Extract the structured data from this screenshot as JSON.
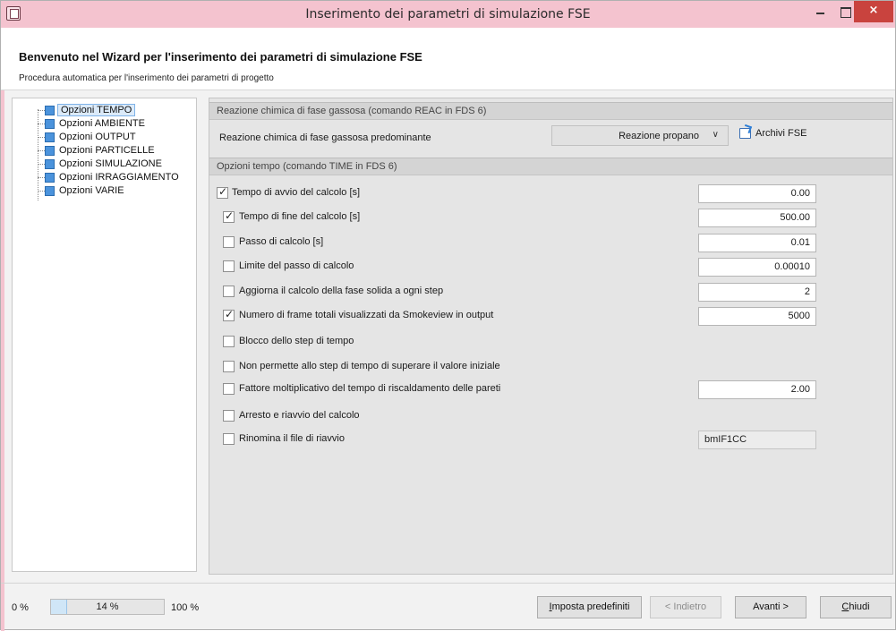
{
  "window": {
    "title": "Inserimento dei parametri di simulazione FSE",
    "close_symbol": "×"
  },
  "header": {
    "title": "Benvenuto nel Wizard per l'inserimento dei parametri di simulazione FSE",
    "subtitle": "Procedura automatica per l'inserimento dei parametri di progetto"
  },
  "tree": {
    "items": [
      {
        "label": "Opzioni TEMPO",
        "selected": true
      },
      {
        "label": "Opzioni AMBIENTE",
        "selected": false
      },
      {
        "label": "Opzioni OUTPUT",
        "selected": false
      },
      {
        "label": "Opzioni PARTICELLE",
        "selected": false
      },
      {
        "label": "Opzioni SIMULAZIONE",
        "selected": false
      },
      {
        "label": "Opzioni IRRAGGIAMENTO",
        "selected": false
      },
      {
        "label": "Opzioni VARIE",
        "selected": false
      }
    ]
  },
  "reac_group": {
    "header": "Reazione chimica di fase gassosa (comando REAC in FDS 6)",
    "label": "Reazione chimica di fase gassosa predominante",
    "dropdown_value": "Reazione propano",
    "archive_label": "Archivi FSE"
  },
  "time_group": {
    "header": "Opzioni tempo (comando TIME in FDS 6)",
    "rows": [
      {
        "label": "Tempo di avvio del calcolo [s]",
        "checked": true,
        "value": "0.00"
      },
      {
        "label": "Tempo di fine del calcolo [s]",
        "checked": true,
        "value": "500.00"
      },
      {
        "label": "Passo di calcolo [s]",
        "checked": false,
        "value": "0.01"
      },
      {
        "label": "Limite del passo di calcolo",
        "checked": false,
        "value": "0.00010"
      },
      {
        "label": "Aggiorna il calcolo della fase solida a ogni step",
        "checked": false,
        "value": "2"
      },
      {
        "label": "Numero di frame totali visualizzati da Smokeview in output",
        "checked": true,
        "value": "5000"
      },
      {
        "label": "Blocco dello step di tempo",
        "checked": false
      },
      {
        "label": "Non permette allo step di tempo di superare il valore iniziale",
        "checked": false
      },
      {
        "label": "Fattore moltiplicativo del tempo di riscaldamento delle pareti",
        "checked": false,
        "value": "2.00"
      },
      {
        "label": "Arresto e riavvio del calcolo",
        "checked": false
      },
      {
        "label": "Rinomina il file di riavvio",
        "checked": false,
        "value": "bmIF1CC"
      }
    ]
  },
  "footer": {
    "progress_min": "0 %",
    "progress_max": "100 %",
    "progress_text": "14 %",
    "progress_value": 0.14,
    "buttons": {
      "defaults_hotkey": "I",
      "defaults_rest": "mposta predefiniti",
      "back": "< Indietro",
      "next": "Avanti >",
      "close_hotkey": "C",
      "close_rest": "hiudi"
    }
  },
  "colors": {
    "titlebar": "#f4c3cf",
    "close_button": "#c9433e",
    "tree_node": "#4b93dc"
  }
}
